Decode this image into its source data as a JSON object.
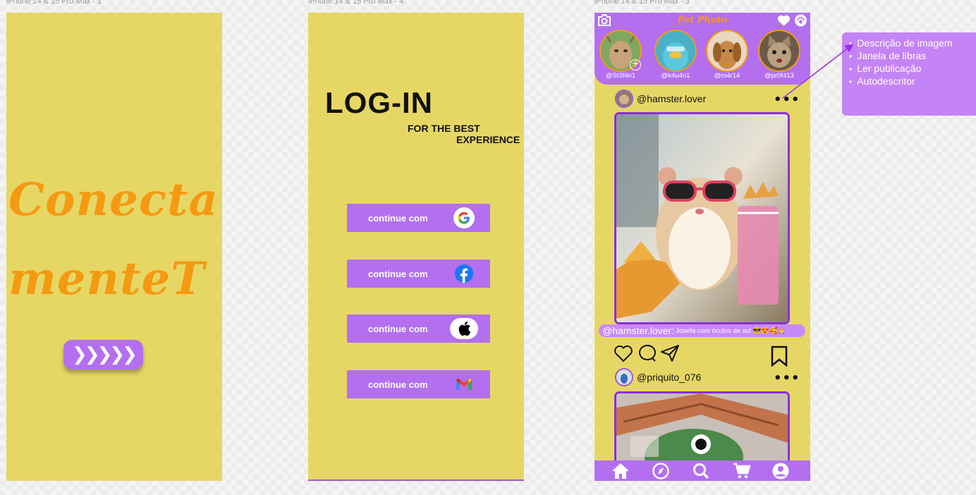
{
  "frames": {
    "f1": {
      "label": "iPhone 14 & 15 Pro Max - 1",
      "title_line1": "Conecta",
      "title_line2": "menteT",
      "arrow_button": "❯❯❯❯❯"
    },
    "f2": {
      "label": "iPhone 14 & 15 Pro Max - 4",
      "title": "LOG-IN",
      "subtitle_line1": "FOR THE BEST",
      "subtitle_line2": "EXPERIENCE",
      "buttons": [
        {
          "label": "continue com",
          "icon": "google-icon"
        },
        {
          "label": "continue com",
          "icon": "facebook-icon"
        },
        {
          "label": "continue com",
          "icon": "apple-icon"
        },
        {
          "label": "continue com",
          "icon": "gmail-icon"
        }
      ]
    },
    "f3": {
      "label": "iPhone 14 & 15 Pro Max - 3",
      "app_title": "Pet Photo",
      "stories": [
        {
          "handle": "@St3f4n1",
          "image": "goat"
        },
        {
          "handle": "@k4u4n1",
          "image": "blue-bird"
        },
        {
          "handle": "@m4r14",
          "image": "dog"
        },
        {
          "handle": "@pr0f413",
          "image": "cat"
        }
      ],
      "posts": [
        {
          "user": "@hamster.lover",
          "image": "hamster with sunglasses",
          "caption_user": "@hamster.lover:",
          "caption_text": "Josefa com óculos de sol 😎😍🥰🙏"
        },
        {
          "user": "@priquito_076",
          "image": "parrot with hat"
        }
      ],
      "nav": [
        "home-icon",
        "compass-icon",
        "search-icon",
        "cart-icon",
        "profile-icon"
      ]
    }
  },
  "annotation": {
    "items": [
      "Descrição de imagem",
      "Janela de libras",
      "Ler publicação",
      "Autodescritor"
    ]
  },
  "colors": {
    "background": "#e6d765",
    "accent": "#b36ff0",
    "orange": "#f49a12"
  }
}
